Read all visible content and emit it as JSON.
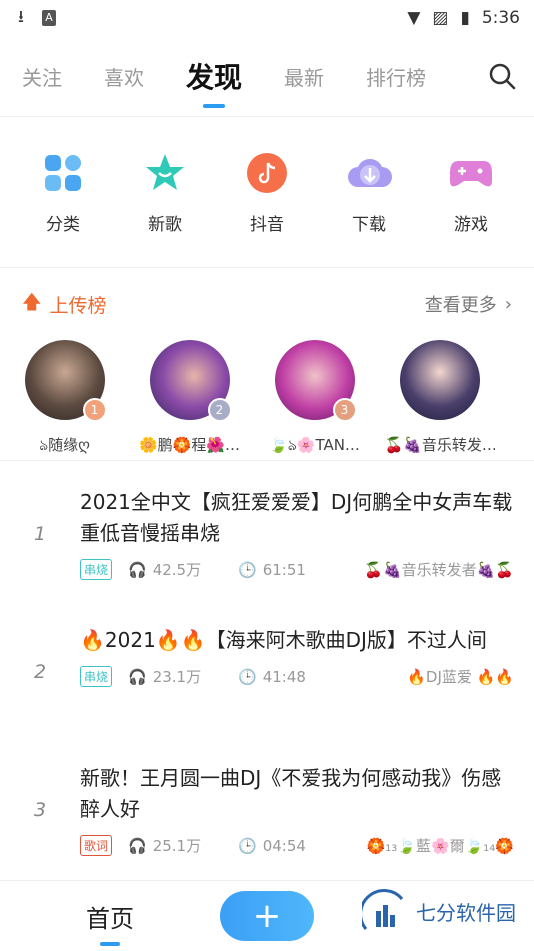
{
  "status": {
    "time": "5:36"
  },
  "topnav": {
    "tabs": [
      "关注",
      "喜欢",
      "发现",
      "最新",
      "排行榜"
    ]
  },
  "categories": [
    {
      "label": "分类"
    },
    {
      "label": "新歌"
    },
    {
      "label": "抖音"
    },
    {
      "label": "下载"
    },
    {
      "label": "游戏"
    }
  ],
  "upload": {
    "title": "上传榜",
    "more": "查看更多"
  },
  "uploaders": [
    {
      "name": "ঌ随缘ღ",
      "rank": "1"
    },
    {
      "name": "🌼鹏🏵️程🌺…",
      "rank": "2"
    },
    {
      "name": "🍃ঌ🌸TAN…",
      "rank": "3"
    },
    {
      "name": "🍒🍇音乐转发…",
      "rank": ""
    }
  ],
  "songs": [
    {
      "num": "1",
      "title": "2021全中文【疯狂爱爱爱】DJ何鹏全中女声车载重低音慢摇串烧",
      "tag": "串烧",
      "plays": "42.5万",
      "duration": "61:51",
      "uploader": "🍒🍇音乐转发者🍇🍒"
    },
    {
      "num": "2",
      "title": "🔥2021🔥🔥【海来阿木歌曲DJ版】不过人间",
      "tag": "串烧",
      "plays": "23.1万",
      "duration": "41:48",
      "uploader": "🔥DJ蓝爱 🔥🔥"
    },
    {
      "num": "3",
      "title": "新歌！王月圆一曲DJ《不爱我为何感动我》伤感醉人好",
      "tag": "歌词",
      "plays": "25.1万",
      "duration": "04:54",
      "uploader": "🏵️₁₃🍃藍🌸爾🍃₁₄🏵️"
    }
  ],
  "bottom": {
    "home": "首页",
    "add": "+",
    "watermark": "七分软件园"
  }
}
